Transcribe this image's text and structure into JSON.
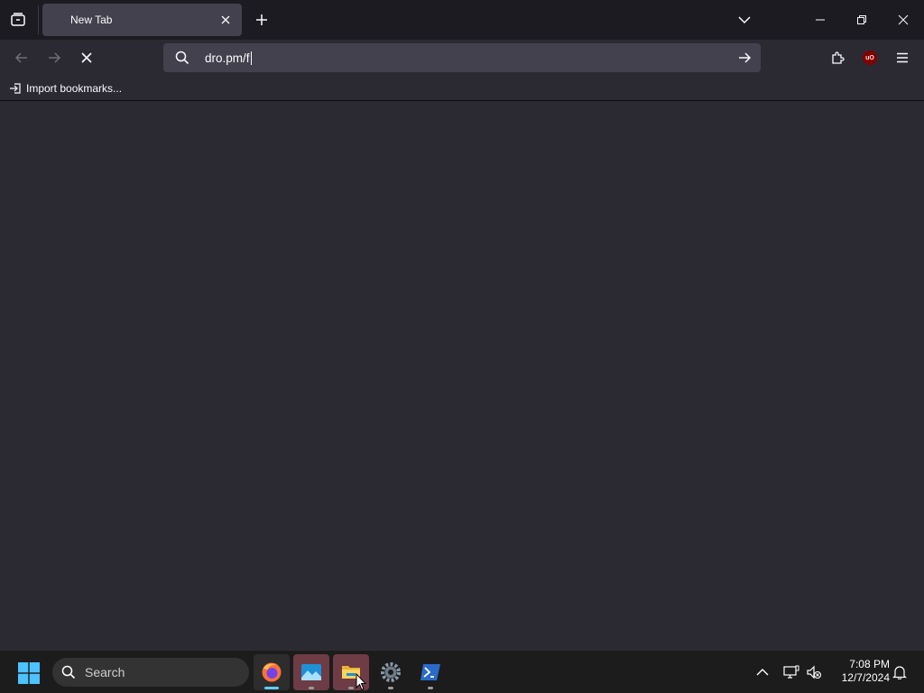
{
  "browser": {
    "tab": {
      "title": "New Tab"
    },
    "url_bar": {
      "value": "dro.pm/f"
    },
    "bookmarks": [
      {
        "label": "Import bookmarks..."
      }
    ],
    "extensions": {
      "ublock_label": "uO"
    }
  },
  "taskbar": {
    "search_label": "Search",
    "apps": [
      {
        "name": "Firefox",
        "icon": "firefox-icon"
      },
      {
        "name": "Photos",
        "icon": "photos-icon"
      },
      {
        "name": "File Explorer",
        "icon": "file-explorer-icon"
      },
      {
        "name": "Settings",
        "icon": "settings-icon"
      },
      {
        "name": "PowerShell",
        "icon": "powershell-icon"
      }
    ],
    "clock": {
      "time": "7:08 PM",
      "date": "12/7/2024"
    }
  },
  "colors": {
    "accent": "#60cdff",
    "tab_bg": "#42414d",
    "toolbar_bg": "#2b2a33",
    "tabstrip_bg": "#1c1b22",
    "ublock_red": "#800000"
  }
}
